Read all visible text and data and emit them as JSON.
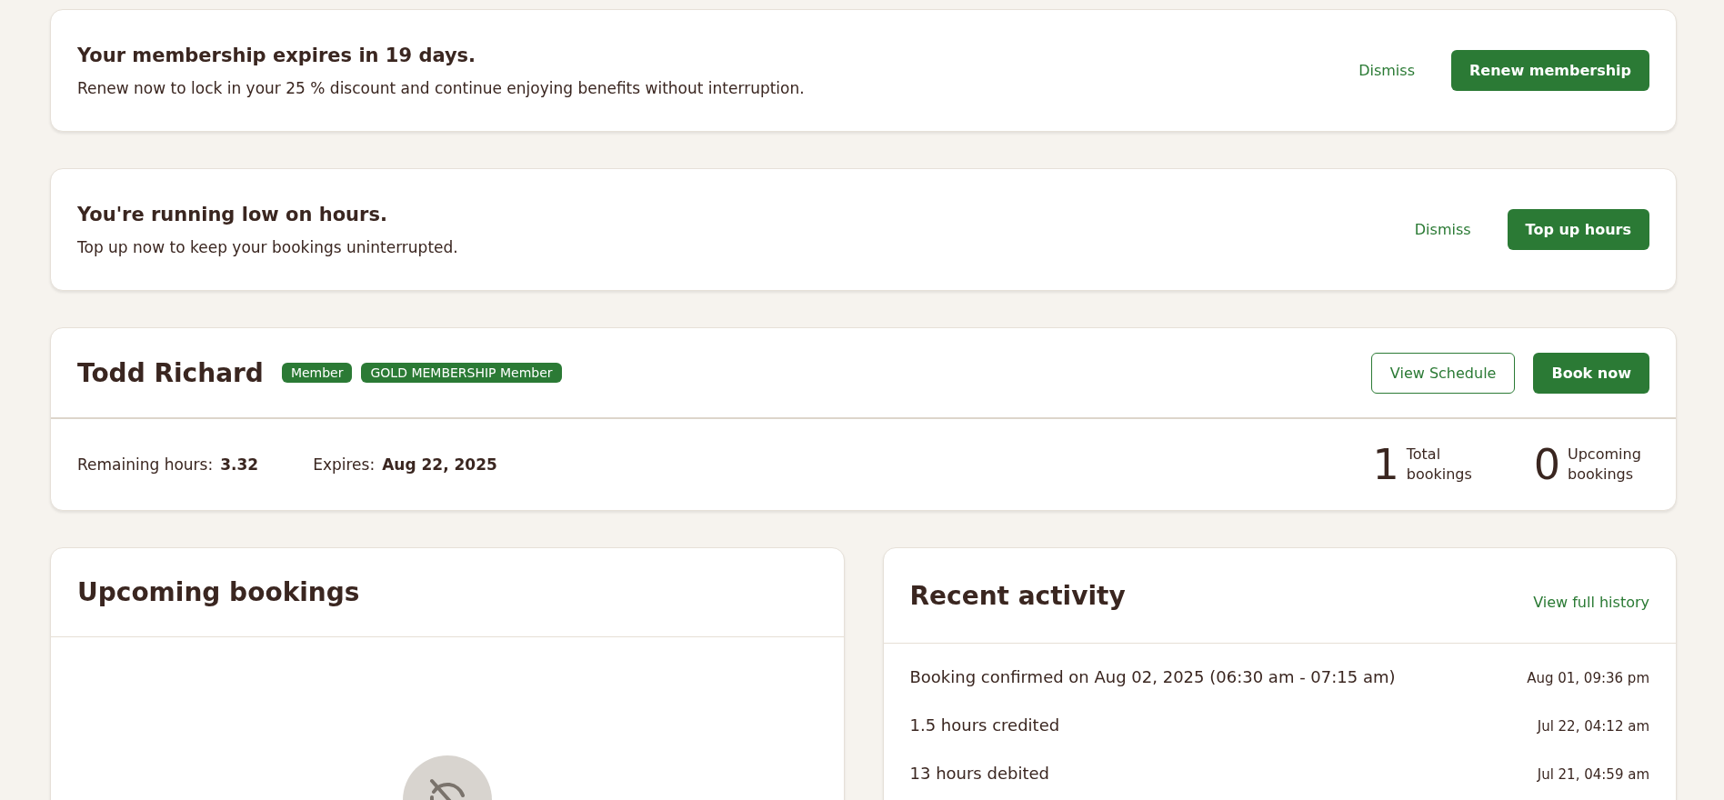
{
  "alerts": [
    {
      "title": "Your membership expires in 19 days.",
      "message": "Renew now to lock in your 25 % discount and continue enjoying benefits without interruption.",
      "dismiss": "Dismiss",
      "action": "Renew membership"
    },
    {
      "title": "You're running low on hours.",
      "message": "Top up now to keep your bookings uninterrupted.",
      "dismiss": "Dismiss",
      "action": "Top up hours"
    }
  ],
  "profile": {
    "name": "Todd Richard",
    "badges": [
      "Member",
      "GOLD MEMBERSHIP Member"
    ],
    "secondary_action": "View Schedule",
    "primary_action": "Book now",
    "facts": [
      {
        "label": "Remaining hours:",
        "value": "3.32"
      },
      {
        "label": "Expires:",
        "value": "Aug 22, 2025"
      }
    ],
    "stats": [
      {
        "number": "1",
        "label": "Total bookings"
      },
      {
        "number": "0",
        "label": "Upcoming bookings"
      }
    ]
  },
  "upcoming": {
    "title": "Upcoming bookings"
  },
  "activity": {
    "title": "Recent activity",
    "link": "View full history",
    "items": [
      {
        "text": "Booking confirmed on Aug 02, 2025 (06:30 am - 07:15 am)",
        "time": "Aug 01, 09:36 pm"
      },
      {
        "text": "1.5 hours credited",
        "time": "Jul 22, 04:12 am"
      },
      {
        "text": "13 hours debited",
        "time": "Jul 21, 04:59 am"
      }
    ]
  }
}
